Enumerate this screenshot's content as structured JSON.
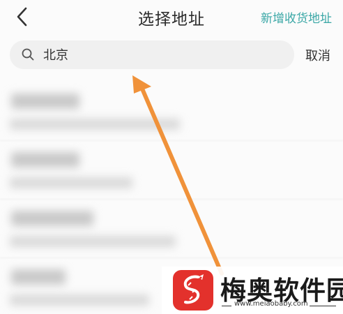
{
  "header": {
    "title": "选择地址",
    "add_link": "新增收货地址",
    "back_icon": "chevron-left-icon"
  },
  "search": {
    "value": "北京",
    "icon": "search-icon",
    "cancel_label": "取消"
  },
  "colors": {
    "accent": "#3aa7a6",
    "arrow": "#f0923a",
    "logo_bg": "#e3312c"
  },
  "list": {
    "items": [
      {
        "name": "",
        "address": ""
      },
      {
        "name": "",
        "address": ""
      },
      {
        "name": "",
        "address": ""
      },
      {
        "name": "",
        "address": ""
      }
    ]
  },
  "watermark": {
    "name": "梅奥软件园",
    "url": "www.meiaobaby.com"
  }
}
